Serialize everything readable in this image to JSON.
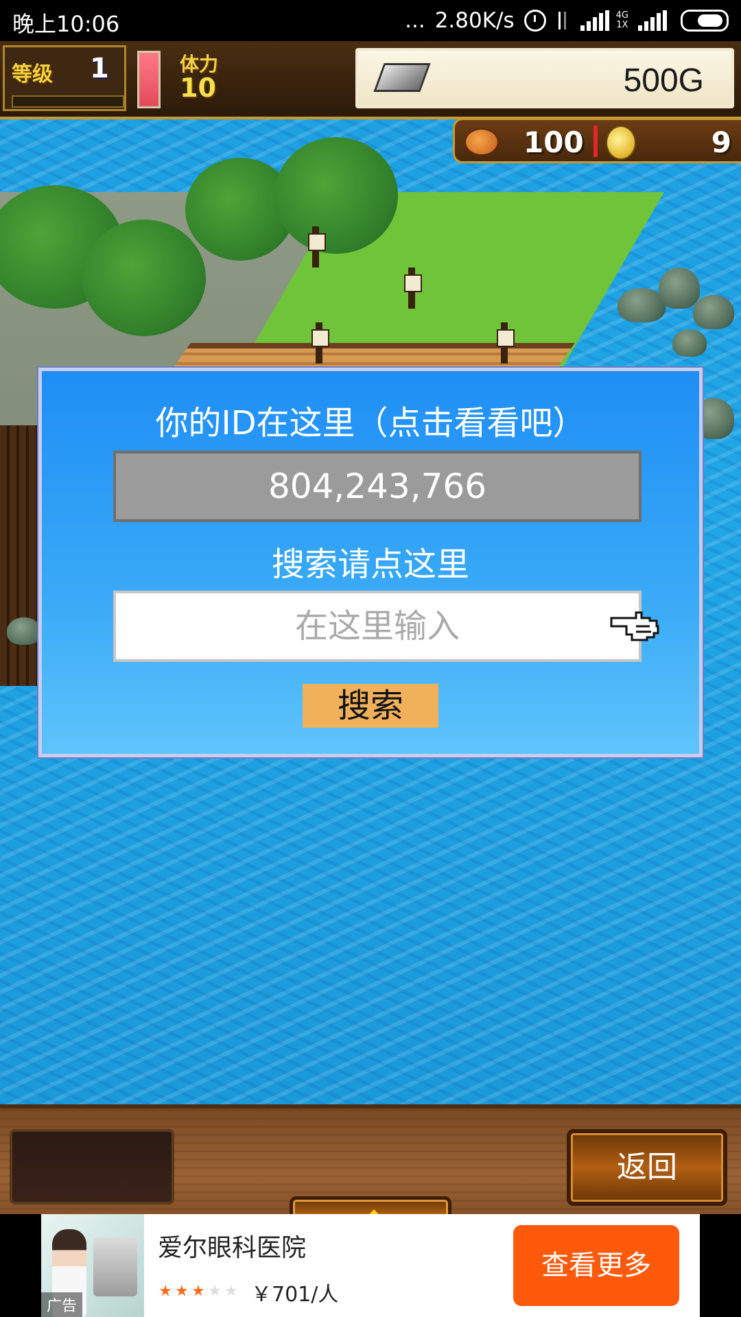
{
  "status_bar": {
    "time": "晚上10:06",
    "dots": "...",
    "net_speed": "2.80K/s",
    "network_type": "4G",
    "sim_label": "1X",
    "icons": [
      "alarm-icon",
      "data-transfer-icon",
      "signal-icon",
      "signal-icon",
      "battery-icon"
    ]
  },
  "hud": {
    "level_label": "等级",
    "level_value": "1",
    "stamina_label": "体力",
    "stamina_value": "10",
    "stamina_fill_fraction": 1.0,
    "money": "500G",
    "food_value": "100",
    "coin_value": "9",
    "icons": [
      "silver-bar-icon",
      "food-icon",
      "coin-icon"
    ]
  },
  "dialog": {
    "title": "你的ID在这里（点击看看吧）",
    "id_value": "804,243,766",
    "search_label": "搜索请点这里",
    "search_placeholder": "在这里输入",
    "search_button": "搜索"
  },
  "bottom_bar": {
    "back_button": "返回"
  },
  "ad": {
    "title": "爱尔眼科医院",
    "tag": "广告",
    "rating": 3.5,
    "rating_max": 5,
    "price": "￥701/人",
    "cta": "查看更多"
  },
  "colors": {
    "dialog_blue": "#1f8ef5",
    "search_button": "#f0b15a",
    "ad_cta": "#ff5a0c"
  }
}
